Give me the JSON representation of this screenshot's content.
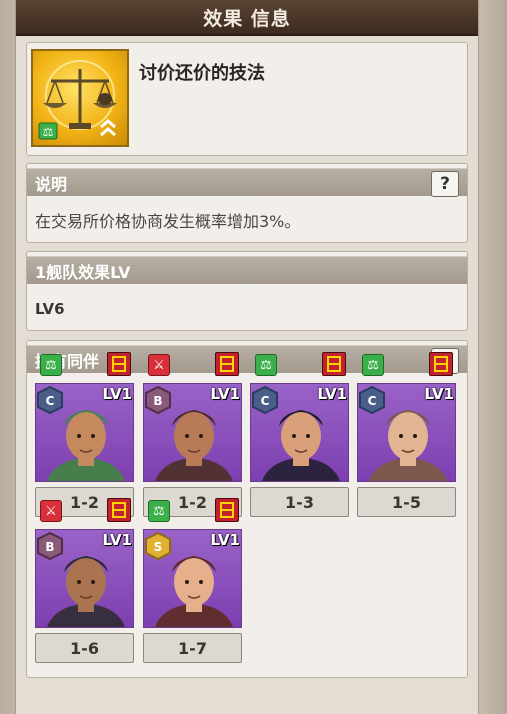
{
  "window": {
    "title": "效果 信息"
  },
  "skill": {
    "name": "讨价还价的技法",
    "icon": "scales-icon"
  },
  "description": {
    "header": "说明",
    "help_label": "?",
    "text": "在交易所价格协商发生概率增加3%。"
  },
  "fleet_effect": {
    "header": "1舰队效果LV",
    "value": "LV6"
  },
  "companions": {
    "header": "拥有同伴",
    "help_label": "?",
    "items": [
      {
        "level": "LV1",
        "tag": "1-2",
        "rank": "C",
        "type": "trade",
        "type_glyph": "⚖",
        "skin": "#c48a5e",
        "hat": "#3d8a3a"
      },
      {
        "level": "LV1",
        "tag": "1-2",
        "rank": "B",
        "type": "battle",
        "type_glyph": "⚔",
        "skin": "#b97b57",
        "hat": "#4a2e1f"
      },
      {
        "level": "LV1",
        "tag": "1-3",
        "rank": "C",
        "type": "trade",
        "type_glyph": "⚖",
        "skin": "#d9a07a",
        "hat": "#1d1d2a"
      },
      {
        "level": "LV1",
        "tag": "1-5",
        "rank": "C",
        "type": "trade",
        "type_glyph": "⚖",
        "skin": "#e1b494",
        "hat": "#7a5b3a"
      },
      {
        "level": "LV1",
        "tag": "1-6",
        "rank": "B",
        "type": "battle",
        "type_glyph": "⚔",
        "skin": "#a9744f",
        "hat": "#2a2a2a"
      },
      {
        "level": "LV1",
        "tag": "1-7",
        "rank": "S",
        "type": "trade",
        "type_glyph": "⚖",
        "skin": "#e6b08c",
        "hat": "#5a2a18"
      }
    ]
  }
}
